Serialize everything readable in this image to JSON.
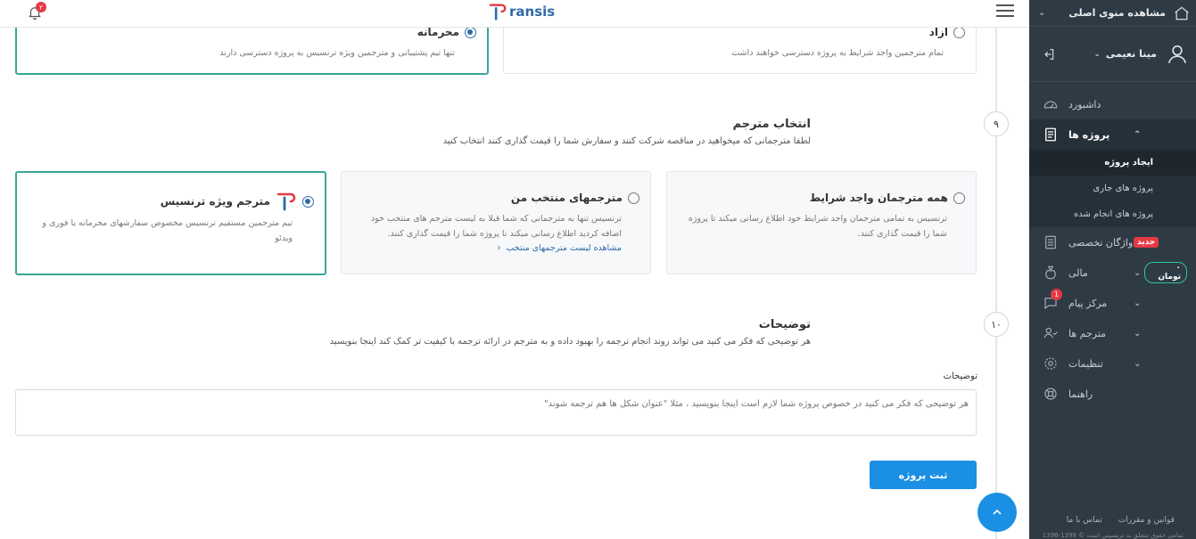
{
  "header": {
    "logo_text": "ransis",
    "notification_count": "۲"
  },
  "sidebar": {
    "main_view_label": "مشاهده منوی اصلی",
    "user_name": "مینا نعیمی",
    "items": [
      {
        "label": "داشبورد"
      },
      {
        "label": "پروژه ها"
      },
      {
        "label": "واژگان تخصصی",
        "badge": "جدید"
      },
      {
        "label": "مالی",
        "badge": "۰ تومان"
      },
      {
        "label": "مرکز پیام",
        "badge": "1"
      },
      {
        "label": "مترجم ها"
      },
      {
        "label": "تنظیمات"
      },
      {
        "label": "راهنما"
      }
    ],
    "submenu": [
      "ایجاد پروژه",
      "پروژه های جاری",
      "پروژه های انجام شده"
    ],
    "footer_links": [
      "قوانین و مقررات",
      "تماس با ما"
    ],
    "copyright": "تمامی حقوق متعلق به ترنسیس است © 1398-1396"
  },
  "privacy": {
    "free": {
      "title": "آزاد",
      "desc": "تمام مترجمین واجد شرایط به پروژه دسترسی خواهند داشت"
    },
    "private": {
      "title": "محرمانه",
      "desc": "تنها تیم پشتیبانی و مترجمین ویژه ترنسیس به پروژه دسترسی دارند"
    }
  },
  "translator_section": {
    "step": "۹",
    "title": "انتخاب مترجم",
    "subtitle": "لطفا مترجمانی که میخواهید در مناقصه شرکت کنند و سفارش شما را قیمت گذاری کنند انتخاب کنید",
    "options": {
      "all": {
        "title": "همه مترجمان واجد شرایط",
        "desc": "ترنسیس به تمامی مترجمان واجد شرایط خود اطلاع رسانی میکند تا پروژه شما را قیمت گذاری کنند."
      },
      "selected": {
        "title": "مترجمهای منتخب من",
        "desc": "ترنسیس تنها به مترجمانی که شما قبلا به لیست مترجم های منتخب خود اضافه کردید اطلاع رسانی میکند تا پروژه شما را قیمت گذاری کنند.",
        "link": "مشاهده لیست مترجمهای منتخب"
      },
      "special": {
        "title": "مترجم ویژه ترنسیس",
        "desc": "تیم مترجمین مستقیم ترنسیس مخصوص سفارشهای محرمانه یا فوری و ویدئو"
      }
    }
  },
  "notes_section": {
    "step": "۱۰",
    "title": "توضیحات",
    "subtitle": "هر توضیحی که فکر می کنید می تواند روند انجام ترجمه را بهبود داده و به مترجم در ارائه ترجمه با کیفیت تر کمک کند اینجا بنویسید",
    "field_label": "توضیحات",
    "placeholder": "هر توضیحی که فکر می کنید در خصوص پروژه شما لازم است اینجا بنویسید ، مثلا \"عنوان شکل ها هم ترجمه شوند\""
  },
  "submit_label": "ثبت پروژه",
  "colors": {
    "sidebar_bg": "#2e3a44",
    "accent": "#1a8fe3",
    "selected_border": "#3aa59a",
    "badge_red": "#e63946"
  }
}
